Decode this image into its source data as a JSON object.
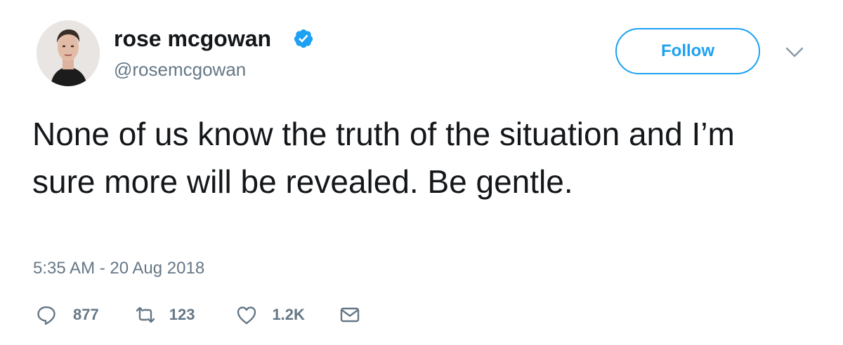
{
  "user": {
    "display_name": "rose mcgowan",
    "handle": "@rosemcgowan",
    "verified": true,
    "avatar_icon": "profile-photo"
  },
  "follow_button": {
    "label": "Follow"
  },
  "menu_icon": "chevron-down-icon",
  "tweet": {
    "text": "None of us know the truth of the situation and I’m sure more will be revealed. Be gentle.",
    "timestamp": "5:35 AM - 20 Aug 2018"
  },
  "actions": {
    "replies": "877",
    "retweets": "123",
    "likes": "1.2K"
  },
  "colors": {
    "accent": "#1da1f2",
    "text": "#14171a",
    "muted": "#657786"
  }
}
